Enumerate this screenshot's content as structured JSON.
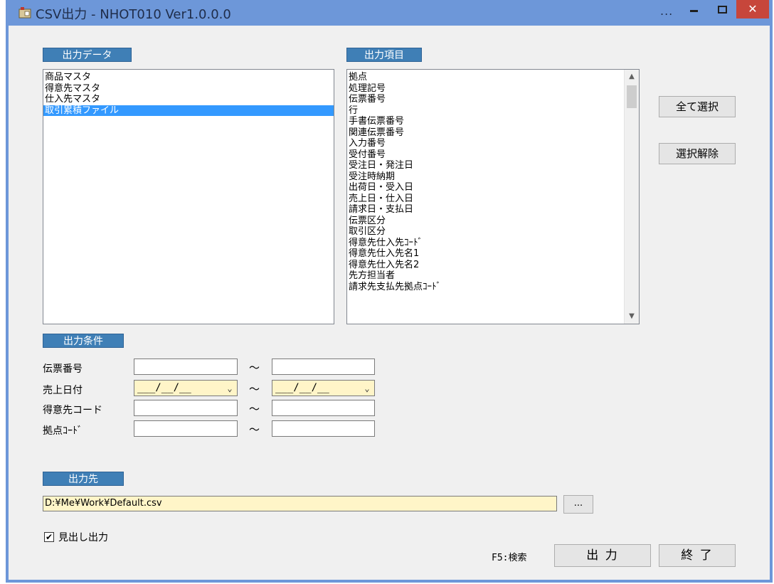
{
  "window": {
    "title": "CSV出力 - NHOT010 Ver1.0.0.0",
    "title_dots": "...",
    "close_glyph": "✕"
  },
  "output_data": {
    "label": "出力データ",
    "items": [
      "商品マスタ",
      "得意先マスタ",
      "仕入先マスタ",
      "取引累積ファイル"
    ],
    "selected_index": 3
  },
  "output_items": {
    "label": "出力項目",
    "items": [
      "拠点",
      "処理記号",
      "伝票番号",
      "行",
      "手書伝票番号",
      "関連伝票番号",
      "入力番号",
      "受付番号",
      "受注日・発注日",
      "受注時納期",
      "出荷日・受入日",
      "売上日・仕入日",
      "請求日・支払日",
      "伝票区分",
      "取引区分",
      "得意先仕入先ｺｰﾄﾞ",
      "得意先仕入先名1",
      "得意先仕入先名2",
      "先方担当者",
      "請求先支払先拠点ｺｰﾄﾞ"
    ]
  },
  "buttons": {
    "select_all": "全て選択",
    "deselect": "選択解除",
    "browse": "...",
    "output": "出 力",
    "exit": "終 了"
  },
  "conditions": {
    "label": "出力条件",
    "tilde": "～",
    "rows": [
      {
        "label": "伝票番号",
        "from": "",
        "to": ""
      },
      {
        "label": "売上日付",
        "from": "___/__/__",
        "to": "___/__/__"
      },
      {
        "label": "得意先コード",
        "from": "",
        "to": ""
      },
      {
        "label": "拠点ｺｰﾄﾞ",
        "from": "",
        "to": ""
      }
    ]
  },
  "destination": {
    "label": "出力先",
    "path": "D:¥Me¥Work¥Default.csv"
  },
  "header_checkbox": {
    "label": "見出し出力",
    "checked": true,
    "check_glyph": "✔"
  },
  "fkey_hint": "F5:検索",
  "colors": {
    "titlebar": "#6d97d9",
    "label_box": "#3f7fb6",
    "selection": "#3399ff",
    "input_yellow": "#fff5c8",
    "close": "#c7463b"
  }
}
